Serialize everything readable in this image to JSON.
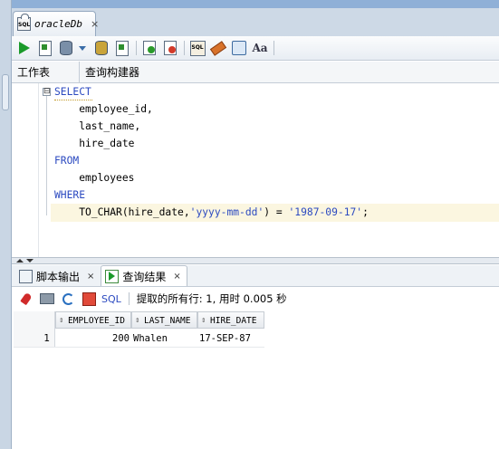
{
  "window": {
    "tab_label": "oracleDb",
    "tab_close": "×"
  },
  "toolbar": {
    "buttons": [
      "run-statement-icon",
      "run-script-icon",
      "autotrace-icon",
      "dropdown-arrow-icon",
      "explain-plan-icon",
      "sql-tuning-icon",
      "commit-icon",
      "rollback-icon",
      "sql-history-icon",
      "clear-icon",
      "navigator-icon",
      "format-case-icon"
    ],
    "case_label": "Aa"
  },
  "subtabs": {
    "worksheet": "工作表",
    "query_builder": "查询构建器"
  },
  "editor": {
    "fold_marker": "⊟",
    "lines": [
      "SELECT",
      "    employee_id,",
      "    last_name,",
      "    hire_date",
      "FROM",
      "    employees",
      "WHERE",
      "    TO_CHAR(hire_date,'yyyy-mm-dd') = '1987-09-17';"
    ],
    "line7_prefix": "    TO_CHAR(hire_date,",
    "line7_str1": "'yyyy-mm-dd'",
    "line7_mid": ") = ",
    "line7_str2": "'1987-09-17'",
    "line7_suffix": ";"
  },
  "bottom_tabs": {
    "script_output": "脚本输出",
    "query_result": "查询结果",
    "close": "×"
  },
  "results_toolbar": {
    "sql_label": "SQL",
    "status": "提取的所有行: 1, 用时 0.005 秒"
  },
  "grid": {
    "columns": [
      "EMPLOYEE_ID",
      "LAST_NAME",
      "HIRE_DATE"
    ],
    "sort_glyph": "⇕",
    "rows": [
      {
        "num": "1",
        "employee_id": "200",
        "last_name": "Whalen",
        "hire_date": "17-SEP-87"
      }
    ]
  }
}
